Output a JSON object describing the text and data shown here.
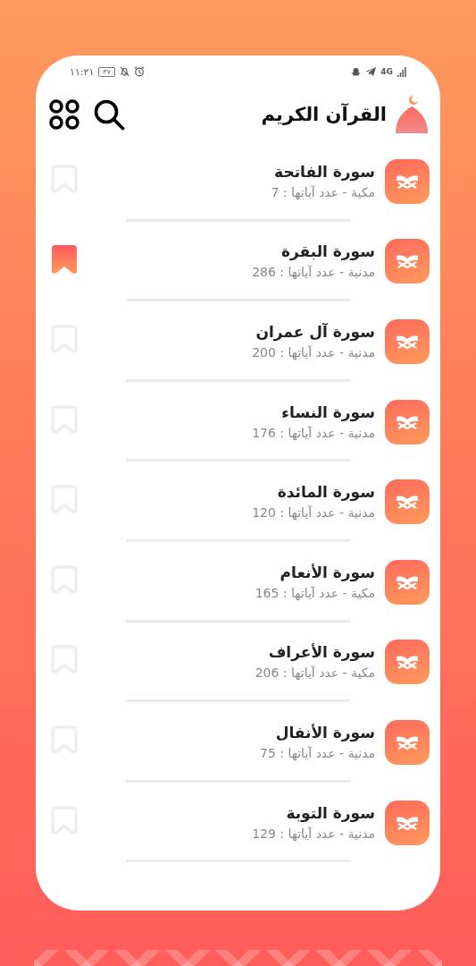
{
  "status_bar": {
    "time": "١١:٢١",
    "battery": "٣٧",
    "network": "4G"
  },
  "header": {
    "title": "القرآن الكريم"
  },
  "surahs": [
    {
      "name": "سورة الفاتحة",
      "info": "مكية - عدد آياتها : 7",
      "bookmarked": false
    },
    {
      "name": "سورة البقرة",
      "info": "مدنية - عدد آياتها : 286",
      "bookmarked": true
    },
    {
      "name": "سورة آل عمران",
      "info": "مدنية - عدد آياتها : 200",
      "bookmarked": false
    },
    {
      "name": "سورة النساء",
      "info": "مدنية - عدد آياتها : 176",
      "bookmarked": false
    },
    {
      "name": "سورة المائدة",
      "info": "مدنية - عدد آياتها : 120",
      "bookmarked": false
    },
    {
      "name": "سورة الأنعام",
      "info": "مكية - عدد آياتها : 165",
      "bookmarked": false
    },
    {
      "name": "سورة الأعراف",
      "info": "مكية - عدد آياتها : 206",
      "bookmarked": false
    },
    {
      "name": "سورة الأنفال",
      "info": "مدنية - عدد آياتها : 75",
      "bookmarked": false
    },
    {
      "name": "سورة التوبة",
      "info": "مدنية - عدد آياتها : 129",
      "bookmarked": false
    }
  ]
}
